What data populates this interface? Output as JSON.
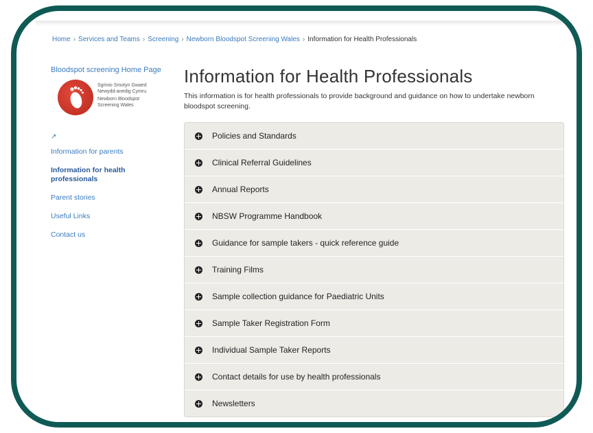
{
  "breadcrumb": {
    "items": [
      "Home",
      "Services and Teams",
      "Screening",
      "Newborn Bloodspot Screening Wales"
    ],
    "current": "Information for Health Professionals",
    "separator": "›"
  },
  "sidebar": {
    "home_link": "Bloodspot screening Home Page",
    "logo": {
      "line1": "Sgrinio Smotyn Gwaed",
      "line2": "Newydd-anedig Cymru",
      "line3": "Newborn Bloodspot",
      "line4": "Screening Wales"
    },
    "external_icon": "↗",
    "items": [
      {
        "label": "Information for parents"
      },
      {
        "label": "Information for health professionals"
      },
      {
        "label": "Parent stories"
      },
      {
        "label": "Useful Links"
      },
      {
        "label": "Contact us"
      }
    ]
  },
  "main": {
    "title": "Information for Health Professionals",
    "intro": "This information is for health professionals to provide background and guidance on how to undertake newborn bloodspot screening.",
    "accordion": [
      {
        "label": "Policies and Standards"
      },
      {
        "label": "Clinical Referral Guidelines"
      },
      {
        "label": "Annual Reports"
      },
      {
        "label": "NBSW Programme Handbook"
      },
      {
        "label": "Guidance for sample takers - quick reference guide"
      },
      {
        "label": "Training Films"
      },
      {
        "label": "Sample collection guidance for Paediatric Units"
      },
      {
        "label": "Sample Taker Registration Form"
      },
      {
        "label": "Individual Sample Taker Reports"
      },
      {
        "label": "Contact details for use by health professionals"
      },
      {
        "label": "Newsletters"
      }
    ]
  },
  "colors": {
    "frame": "#0f5a55",
    "link": "#3a7bbf",
    "accordion_bg": "#ecebe6",
    "logo_red": "#c8322a"
  }
}
